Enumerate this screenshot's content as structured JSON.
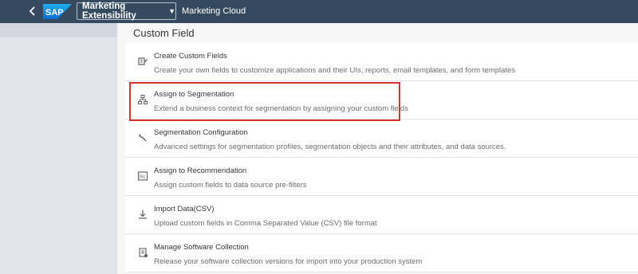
{
  "shell": {
    "logo": "SAP",
    "app_title": "Marketing Extensibility",
    "subtitle": "Marketing Cloud"
  },
  "page": {
    "title": "Custom Field"
  },
  "items": [
    {
      "title": "Create Custom Fields",
      "description": "Create your own fields to customize applications and their UIs, reports, email templates, and form templates",
      "icon": "custom-fields-icon"
    },
    {
      "title": "Assign to Segmentation",
      "description": "Extend a business context for segmentation by assigning your custom fields",
      "icon": "hierarchy-icon"
    },
    {
      "title": "Segmentation Configuration",
      "description": "Advanced settings for segmentation profiles, segmentation objects and their attributes, and data sources.",
      "icon": "wrench-icon"
    },
    {
      "title": "Assign to Recommendation",
      "description": "Assign custom fields to data source pre-filters",
      "icon": "recommendation-icon"
    },
    {
      "title": "Import Data(CSV)",
      "description": "Upload custom fields in Comma Separated Value (CSV) file format",
      "icon": "download-icon"
    },
    {
      "title": "Manage Software Collection",
      "description": "Release your software collection versions for import into your production system",
      "icon": "collection-icon"
    }
  ],
  "colors": {
    "shell": "#354a5f",
    "highlight": "#d9312c",
    "brand": "#1a73c7"
  }
}
